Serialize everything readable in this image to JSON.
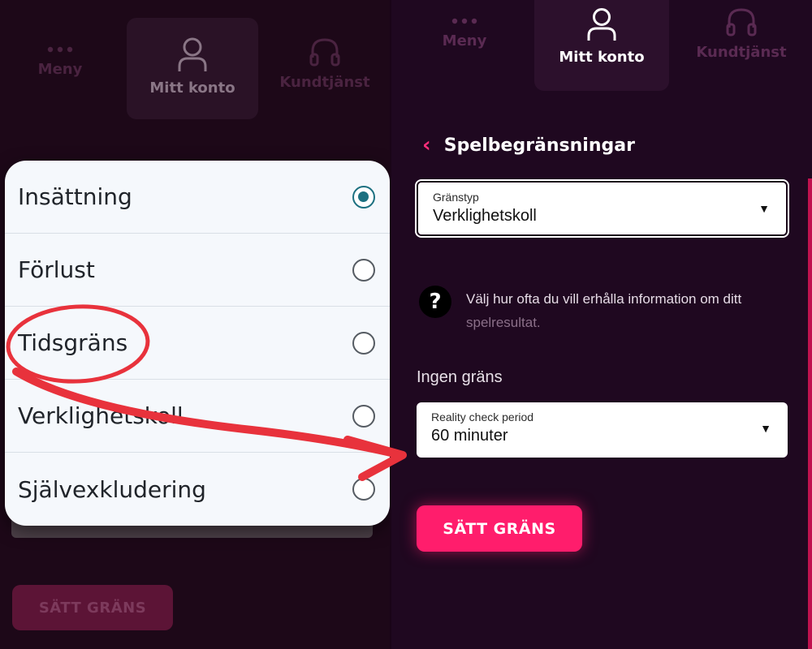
{
  "left": {
    "nav": {
      "menu_label": "Meny",
      "account_label": "Mitt konto",
      "support_label": "Kundtjänst"
    },
    "options": [
      {
        "label": "Insättning",
        "selected": true
      },
      {
        "label": "Förlust",
        "selected": false
      },
      {
        "label": "Tidsgräns",
        "selected": false
      },
      {
        "label": "Verklighetskoll",
        "selected": false
      },
      {
        "label": "Självexkludering",
        "selected": false
      }
    ],
    "button_label": "SÄTT GRÄNS"
  },
  "right": {
    "nav": {
      "menu_label": "Meny",
      "account_label": "Mitt konto",
      "support_label": "Kundtjänst"
    },
    "page_title": "Spelbegränsningar",
    "limit_type": {
      "label": "Gränstyp",
      "value": "Verklighetskoll"
    },
    "info_text_1": "Välj hur ofta du vill erhålla information om ditt",
    "info_text_2": "spelresultat.",
    "no_limit_label": "Ingen gräns",
    "period": {
      "label": "Reality check period",
      "value": "60 minuter"
    },
    "button_label": "SÄTT GRÄNS"
  },
  "colors": {
    "accent": "#ff1d6c",
    "background": "#1f0820",
    "radio_selected": "#1c7080",
    "annotation": "#e8323c"
  },
  "icons": {
    "menu": "dots-icon",
    "account": "user-icon",
    "support": "headset-icon",
    "back": "chevron-left-icon",
    "help": "question-icon",
    "caret": "caret-down-icon"
  }
}
